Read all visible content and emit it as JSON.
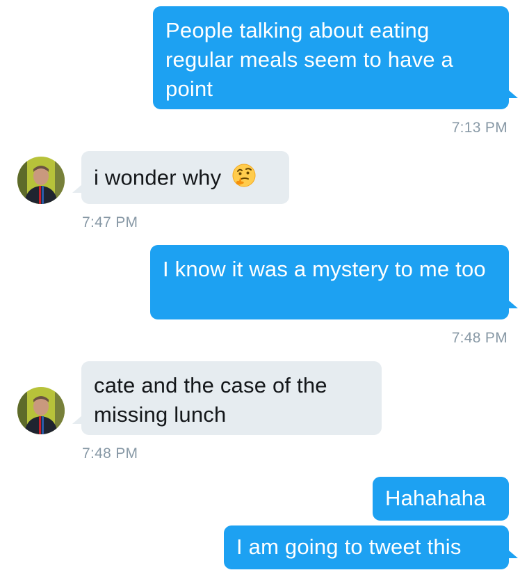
{
  "colors": {
    "outgoing_bubble": "#1da1f2",
    "incoming_bubble": "#e6ecf0",
    "timestamp": "#8899a6"
  },
  "messages": [
    {
      "direction": "outgoing",
      "text": "People talking about eating regular meals seem to have a point",
      "time": "7:13 PM"
    },
    {
      "direction": "incoming",
      "text": "i wonder why",
      "emoji": "thinking-face-icon",
      "time": "7:47 PM"
    },
    {
      "direction": "outgoing",
      "text": "I know it was a mystery to me too",
      "time": "7:48 PM"
    },
    {
      "direction": "incoming",
      "text": "cate and the case of the missing lunch",
      "time": "7:48 PM"
    },
    {
      "direction": "outgoing",
      "text": "Hahahaha"
    },
    {
      "direction": "outgoing",
      "text": "I am going to tweet this"
    }
  ]
}
